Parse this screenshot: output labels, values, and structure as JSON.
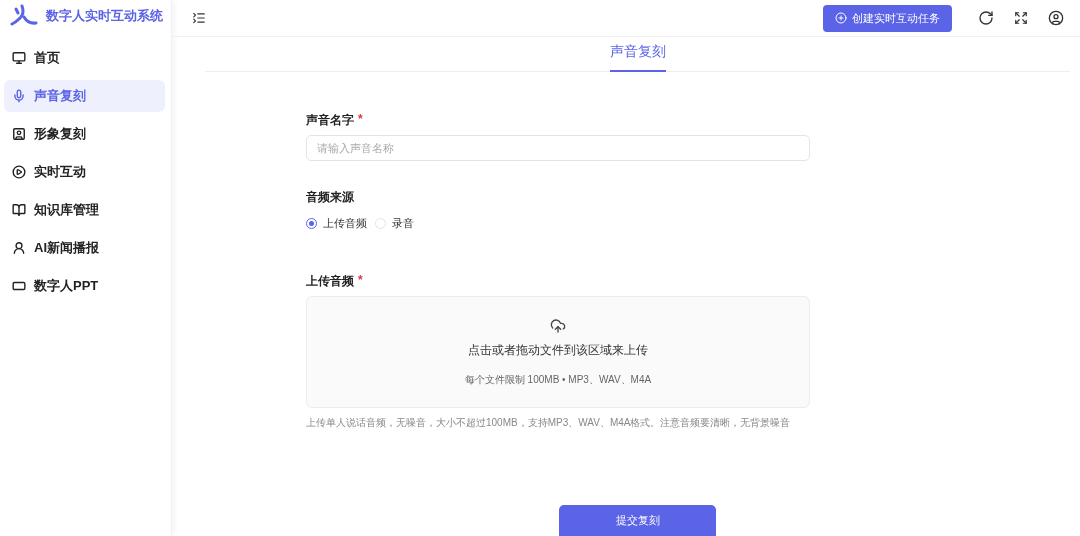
{
  "app": {
    "title": "数字人实时互动系统"
  },
  "sidebar": {
    "items": [
      {
        "label": "首页",
        "kind": "monitor",
        "selected": false
      },
      {
        "label": "声音复刻",
        "kind": "mic",
        "selected": true
      },
      {
        "label": "形象复刻",
        "kind": "portrait",
        "selected": false
      },
      {
        "label": "实时互动",
        "kind": "play",
        "selected": false
      },
      {
        "label": "知识库管理",
        "kind": "book",
        "selected": false
      },
      {
        "label": "AI新闻播报",
        "kind": "broadcast",
        "selected": false
      },
      {
        "label": "数字人PPT",
        "kind": "screen",
        "selected": false
      }
    ]
  },
  "header": {
    "create_button": "创建实时互动任务"
  },
  "tabs": [
    {
      "label": "声音复刻",
      "selected": true
    }
  ],
  "form": {
    "name_field": {
      "label": "声音名字",
      "required_mark": "*",
      "placeholder": "请输入声音名称"
    },
    "source": {
      "label": "音频来源",
      "options": [
        {
          "label": "上传音频",
          "selected": true
        },
        {
          "label": "录音",
          "selected": false
        }
      ]
    },
    "upload": {
      "label": "上传音频",
      "required_mark": "*",
      "title": "点击或者拖动文件到该区域来上传",
      "limits": "每个文件限制 100MB • MP3、WAV、M4A",
      "hint": "上传单人说话音频，无噪音，大小不超过100MB，支持MP3、WAV、M4A格式。注意音频要清晰，无背景噪音"
    },
    "submit": "提交复刻"
  }
}
